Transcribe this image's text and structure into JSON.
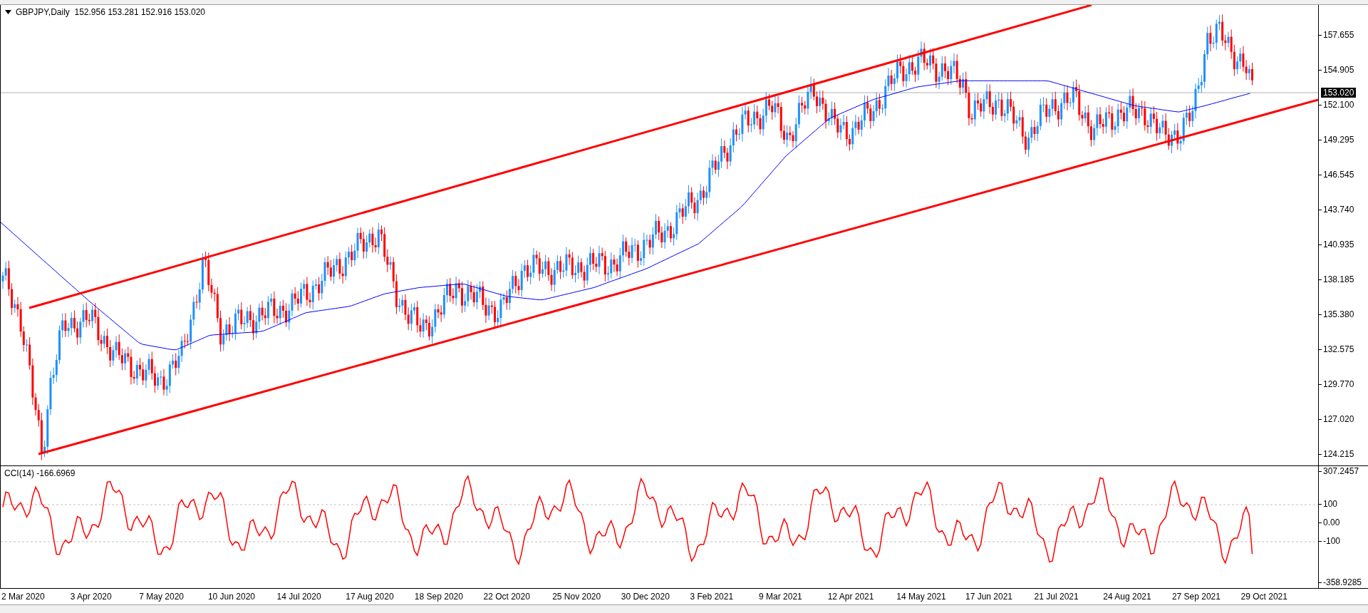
{
  "chart": {
    "header": "GBPJPY,Daily  152.956 153.281 152.916 153.020",
    "current_price": "153.020",
    "price_axis": [
      "157.655",
      "154.905",
      "152.100",
      "149.295",
      "146.545",
      "143.740",
      "140.935",
      "138.185",
      "135.380",
      "132.575",
      "129.770",
      "127.020",
      "124.215"
    ]
  },
  "indicator": {
    "label": "CCI(14) -166.6969",
    "axis": [
      "307.2457",
      "100",
      "0.00",
      "-100",
      "-358.9285"
    ]
  },
  "time_axis": [
    "2 Mar 2020",
    "3 Apr 2020",
    "7 May 2020",
    "10 Jun 2020",
    "14 Jul 2020",
    "17 Aug 2020",
    "18 Sep 2020",
    "22 Oct 2020",
    "25 Nov 2020",
    "30 Dec 2020",
    "3 Feb 2021",
    "9 Mar 2021",
    "12 Apr 2021",
    "14 May 2021",
    "17 Jun 2021",
    "21 Jul 2021",
    "24 Aug 2021",
    "27 Sep 2021",
    "29 Oct 2021"
  ]
}
